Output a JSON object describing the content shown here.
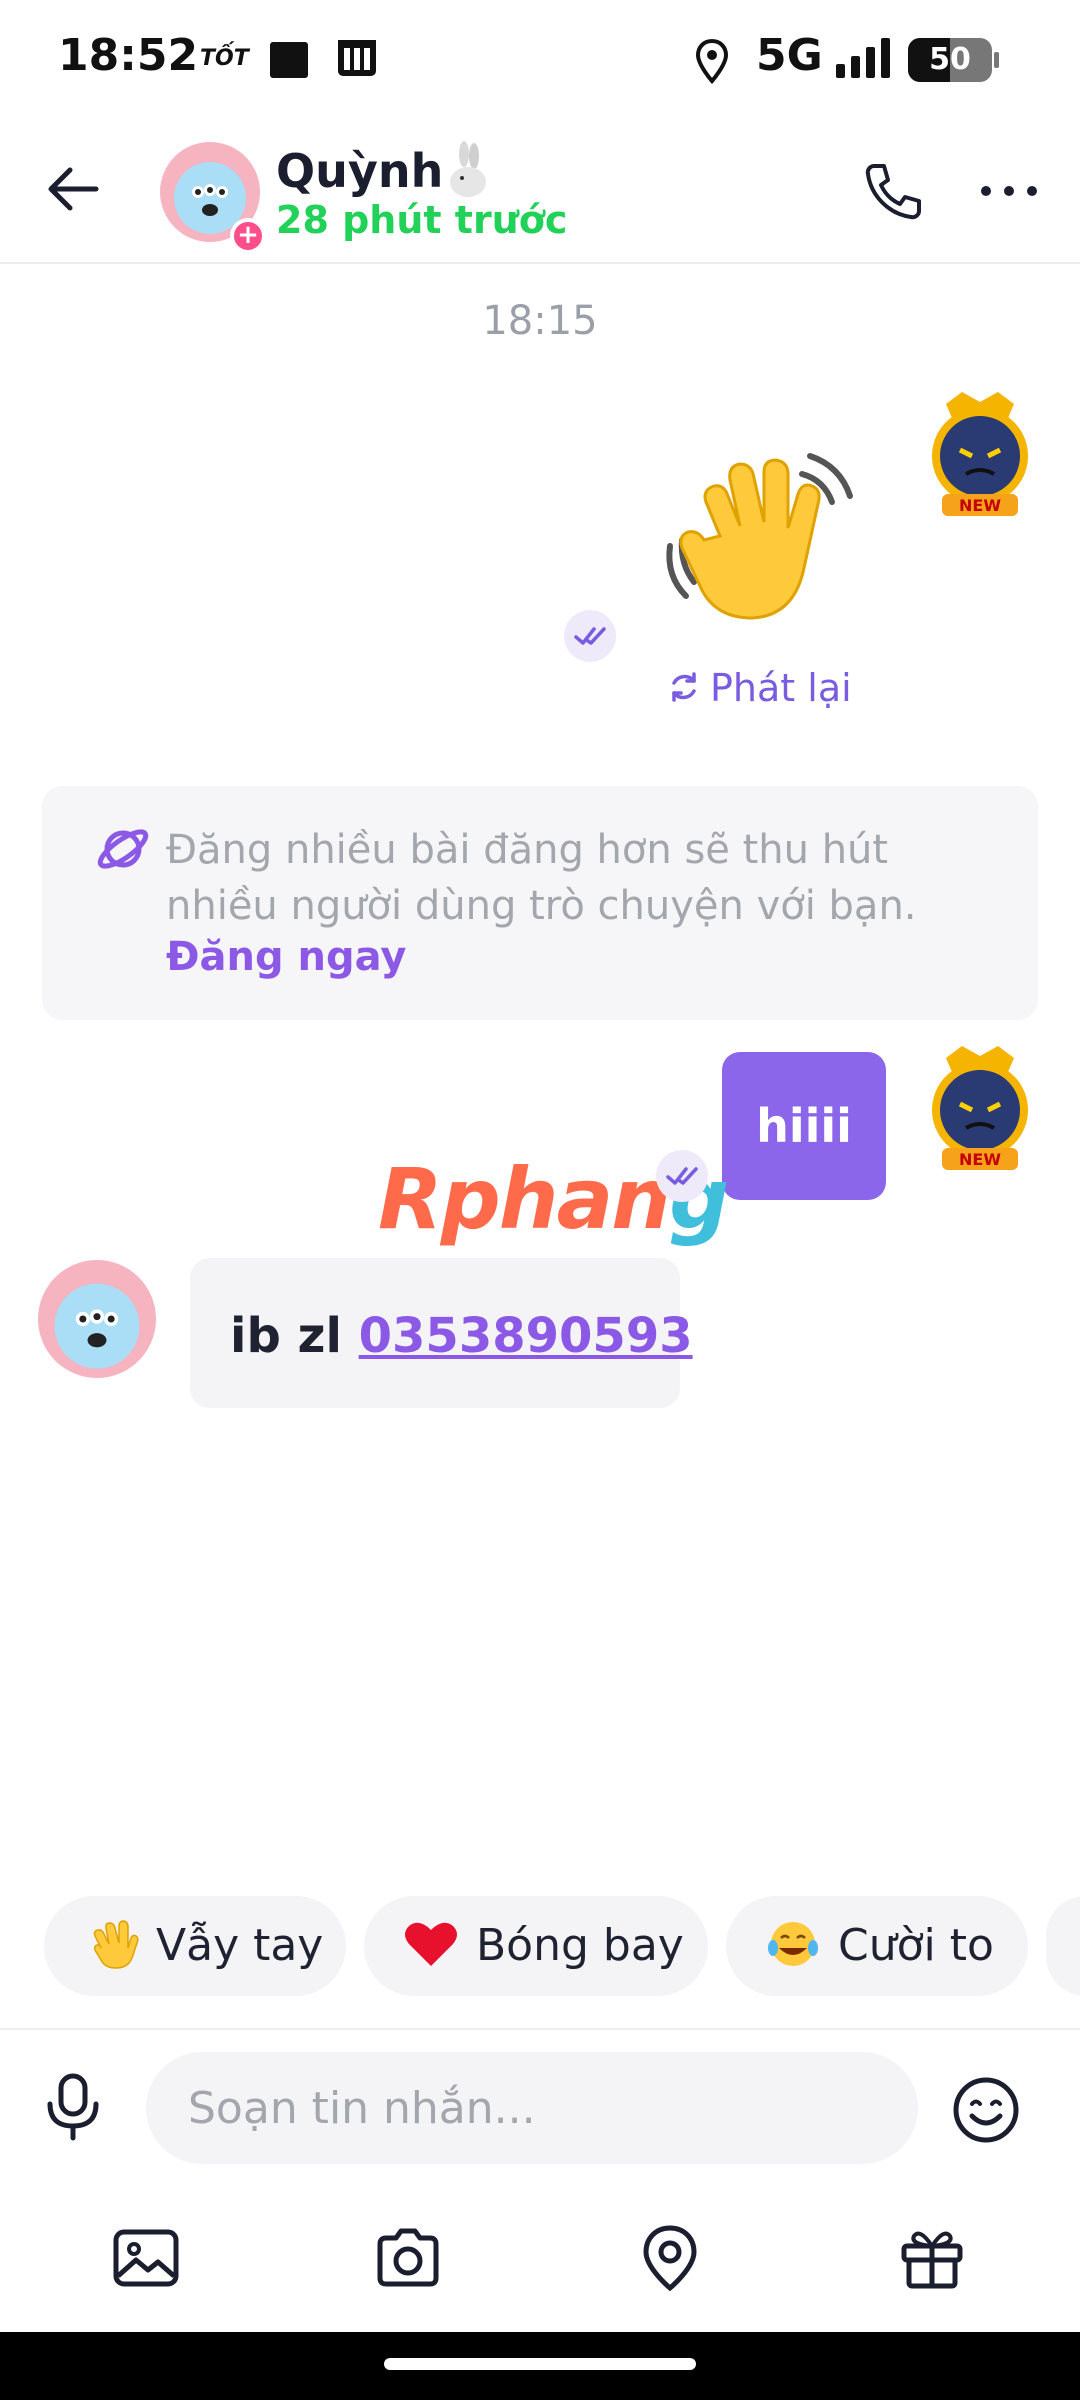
{
  "status_bar": {
    "time": "18:52",
    "carrier_badge": "TỐT",
    "network": "5G",
    "battery": "50",
    "battery_level": 0.5
  },
  "header": {
    "contact_name": "Quỳnh",
    "last_seen": "28 phút trước",
    "badge_plus": "+"
  },
  "chat": {
    "time_separator": "18:15",
    "wave_sticker_emoji": "👋",
    "replay_label": "Phát lại",
    "tip": {
      "text": "Đăng nhiều bài đăng hơn sẽ thu hút nhiều người dùng trò chuyện với bạn.",
      "link": "Đăng ngay"
    },
    "outgoing_message": "hiiii",
    "watermark_a": "Rphan",
    "watermark_b": "g",
    "sticker_badge": "NEW",
    "incoming_message_prefix": "ib zl ",
    "incoming_phone": "0353890593"
  },
  "quick_replies": [
    {
      "emoji": "👋",
      "label": "Vẫy tay"
    },
    {
      "emoji": "❤️",
      "label": "Bóng bay"
    },
    {
      "emoji": "😂",
      "label": "Cười to"
    }
  ],
  "composer": {
    "placeholder": "Soạn tin nhắn..."
  },
  "colors": {
    "accent": "#8c66ea",
    "online_green": "#21d158",
    "link_purple": "#8b59e6"
  }
}
